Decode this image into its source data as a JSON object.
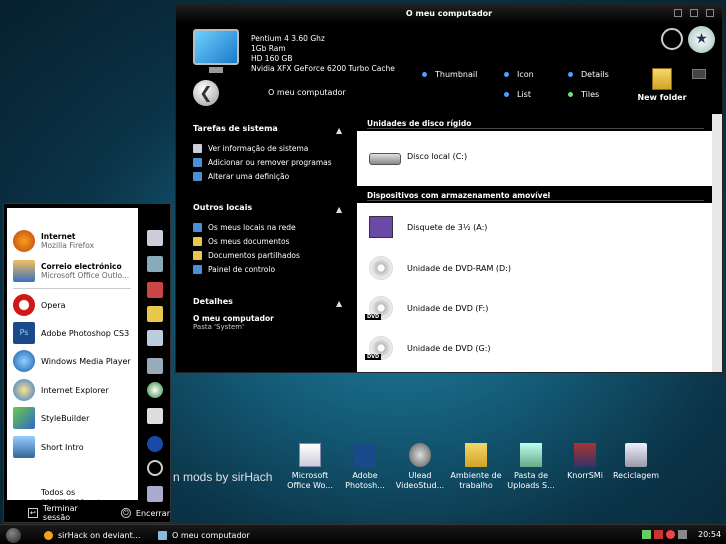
{
  "watermark": "n mods by sirHach",
  "window": {
    "title": "O meu computador",
    "specs": [
      "Pentium 4 3.60 Ghz",
      "1Gb Ram",
      "HD 160 GB",
      "Nvidia XFX GeForce 6200 Turbo Cache"
    ],
    "current_location": "O meu computador",
    "views": {
      "thumbnail": "Thumbnail",
      "icon": "Icon",
      "details": "Details",
      "list": "List",
      "tiles": "Tiles"
    },
    "new_folder": "New folder"
  },
  "tasks": {
    "system": {
      "title": "Tarefas de sistema",
      "items": [
        "Ver informação de sistema",
        "Adicionar ou remover programas",
        "Alterar uma definição"
      ]
    },
    "other": {
      "title": "Outros locais",
      "items": [
        "Os meus locais na rede",
        "Os meus documentos",
        "Documentos partilhados",
        "Painel de controlo"
      ]
    },
    "details": {
      "title": "Detalhes",
      "name": "O meu computador",
      "desc": "Pasta 'System'"
    }
  },
  "content": {
    "hdd_section": "Unidades de disco rígido",
    "local_disk": "Disco local (C:)",
    "removable_section": "Dispositivos com armazenamento amovível",
    "floppy": "Disquete de 3½ (A:)",
    "dvdram": "Unidade de DVD-RAM (D:)",
    "dvd_f": "Unidade de DVD (F:)",
    "dvd_g": "Unidade de DVD (G:)",
    "dvd_badge": "DVD"
  },
  "start_menu": {
    "internet": {
      "label": "Internet",
      "sub": "Mozilla Firefox"
    },
    "email": {
      "label": "Correio electrónico",
      "sub": "Microsoft Office Outlo..."
    },
    "items": [
      "Opera",
      "Adobe Photoshop CS3",
      "Windows Media Player",
      "Internet Explorer",
      "StyleBuilder",
      "Short Intro"
    ],
    "all_programs": "Todos os programas",
    "logoff": "Terminar sessão",
    "shutdown": "Encerrar"
  },
  "desktop_icons": [
    {
      "l1": "Microsoft",
      "l2": "Office Wo..."
    },
    {
      "l1": "Adobe",
      "l2": "Photosh..."
    },
    {
      "l1": "Ulead",
      "l2": "VideoStud..."
    },
    {
      "l1": "Ambiente de",
      "l2": "trabalho"
    },
    {
      "l1": "Pasta de",
      "l2": "Uploads S..."
    },
    {
      "l1": "KnorrSMi",
      "l2": ""
    },
    {
      "l1": "Reciclagem",
      "l2": ""
    }
  ],
  "taskbar": {
    "task1": "sirHack on deviant...",
    "task2": "O meu computador",
    "time": "20:54"
  },
  "colors": {
    "accent": "#1f7f9e",
    "window_bg": "#000000"
  }
}
